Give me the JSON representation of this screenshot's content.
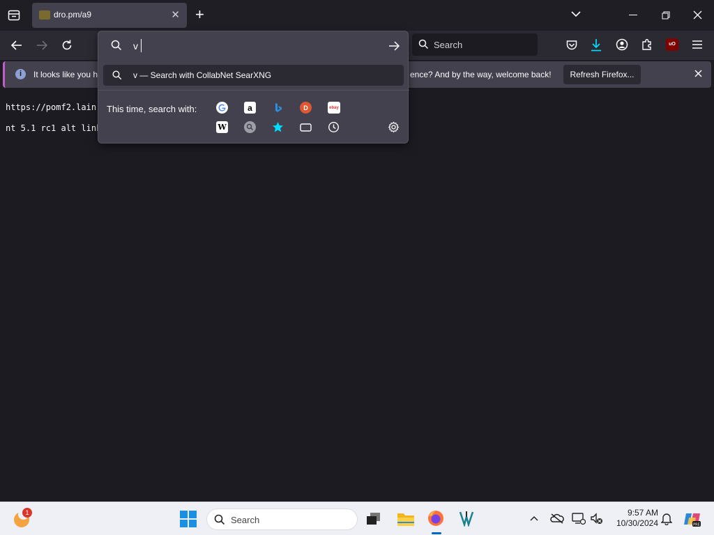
{
  "tab": {
    "title": "dro.pm/a9"
  },
  "toolbar": {
    "search_placeholder": "Search"
  },
  "notification": {
    "text_left": "It looks like you ha",
    "text_right": "ence? And by the way, welcome back!",
    "button_label": "Refresh Firefox..."
  },
  "content": {
    "line1": "https://pomf2.lain.",
    "line2": "nt 5.1 rc1 alt link"
  },
  "urlbar": {
    "value": "v",
    "result_text": "v — Search with CollabNet SearXNG",
    "oneoff_label": "This time, search with:"
  },
  "taskbar": {
    "search_placeholder": "Search",
    "time": "9:57 AM",
    "date": "10/30/2024",
    "weather_badge": "1"
  },
  "colors": {
    "accent": "#00ddff",
    "notif_stripe": "#c05fcc",
    "ublock": "#800000"
  }
}
